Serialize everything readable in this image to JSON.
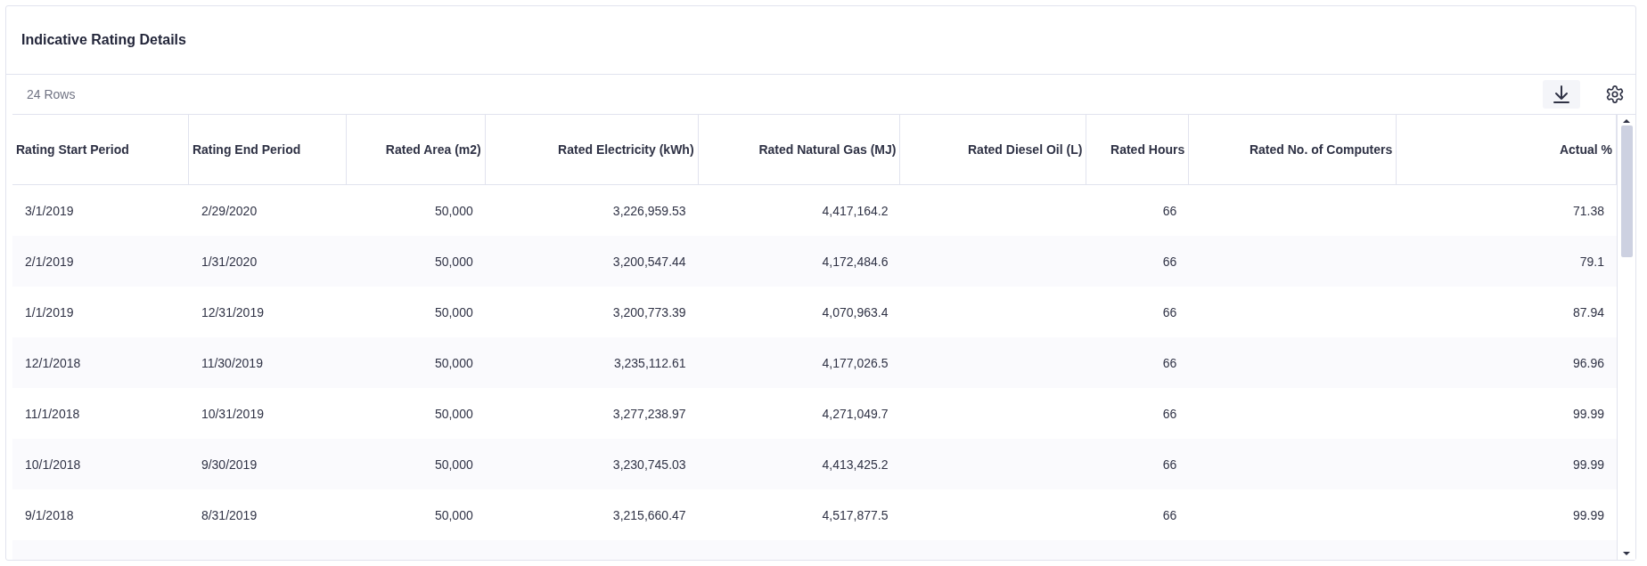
{
  "panel": {
    "title": "Indicative Rating Details"
  },
  "toolbar": {
    "row_count": "24 Rows"
  },
  "table": {
    "columns": [
      "Rating Start Period",
      "Rating End Period",
      "Rated Area (m2)",
      "Rated Electricity (kWh)",
      "Rated Natural Gas (MJ)",
      "Rated Diesel Oil (L)",
      "Rated Hours",
      "Rated No. of Computers",
      "Actual %"
    ],
    "rows": [
      [
        "3/1/2019",
        "2/29/2020",
        "50,000",
        "3,226,959.53",
        "4,417,164.2",
        null,
        "66",
        null,
        "71.38"
      ],
      [
        "2/1/2019",
        "1/31/2020",
        "50,000",
        "3,200,547.44",
        "4,172,484.6",
        null,
        "66",
        null,
        "79.1"
      ],
      [
        "1/1/2019",
        "12/31/2019",
        "50,000",
        "3,200,773.39",
        "4,070,963.4",
        null,
        "66",
        null,
        "87.94"
      ],
      [
        "12/1/2018",
        "11/30/2019",
        "50,000",
        "3,235,112.61",
        "4,177,026.5",
        null,
        "66",
        null,
        "96.96"
      ],
      [
        "11/1/2018",
        "10/31/2019",
        "50,000",
        "3,277,238.97",
        "4,271,049.7",
        null,
        "66",
        null,
        "99.99"
      ],
      [
        "10/1/2018",
        "9/30/2019",
        "50,000",
        "3,230,745.03",
        "4,413,425.2",
        null,
        "66",
        null,
        "99.99"
      ],
      [
        "9/1/2018",
        "8/31/2019",
        "50,000",
        "3,215,660.47",
        "4,517,877.5",
        null,
        "66",
        null,
        "99.99"
      ]
    ]
  }
}
